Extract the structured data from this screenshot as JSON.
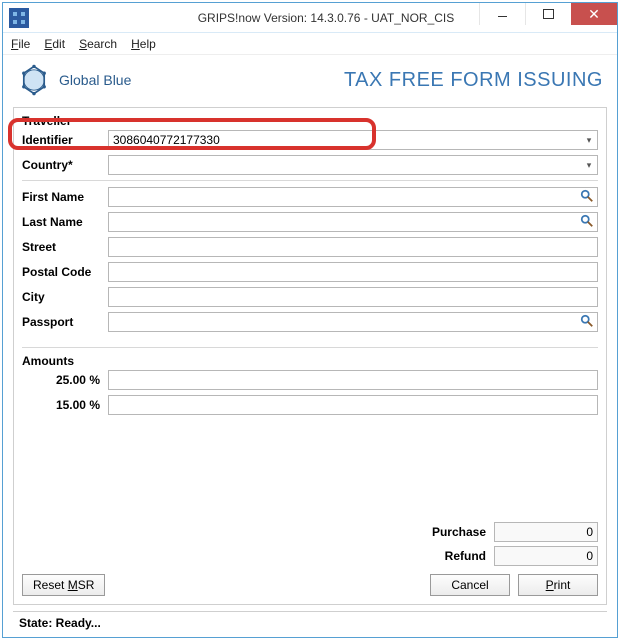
{
  "window": {
    "title": "GRIPS!now Version: 14.3.0.76 - UAT_NOR_CIS",
    "close_glyph": "✕"
  },
  "menu": {
    "file": "File",
    "edit": "Edit",
    "search": "Search",
    "help": "Help"
  },
  "brand": {
    "name": "Global Blue"
  },
  "page_title": "TAX FREE FORM ISSUING",
  "traveller": {
    "group_label": "Traveller",
    "identifier_label": "Identifier",
    "identifier_value": "3086040772177330",
    "country_label": "Country*",
    "country_value": "",
    "first_name_label": "First Name",
    "first_name_value": "",
    "last_name_label": "Last Name",
    "last_name_value": "",
    "street_label": "Street",
    "street_value": "",
    "postal_code_label": "Postal Code",
    "postal_code_value": "",
    "city_label": "City",
    "city_value": "",
    "passport_label": "Passport",
    "passport_value": ""
  },
  "amounts": {
    "group_label": "Amounts",
    "rate1_label": "25.00 %",
    "rate1_value": "",
    "rate2_label": "15.00 %",
    "rate2_value": ""
  },
  "totals": {
    "purchase_label": "Purchase",
    "purchase_value": "0",
    "refund_label": "Refund",
    "refund_value": "0"
  },
  "buttons": {
    "reset_msr": "Reset MSR",
    "cancel": "Cancel",
    "print": "Print"
  },
  "status": {
    "text": "State:  Ready..."
  }
}
